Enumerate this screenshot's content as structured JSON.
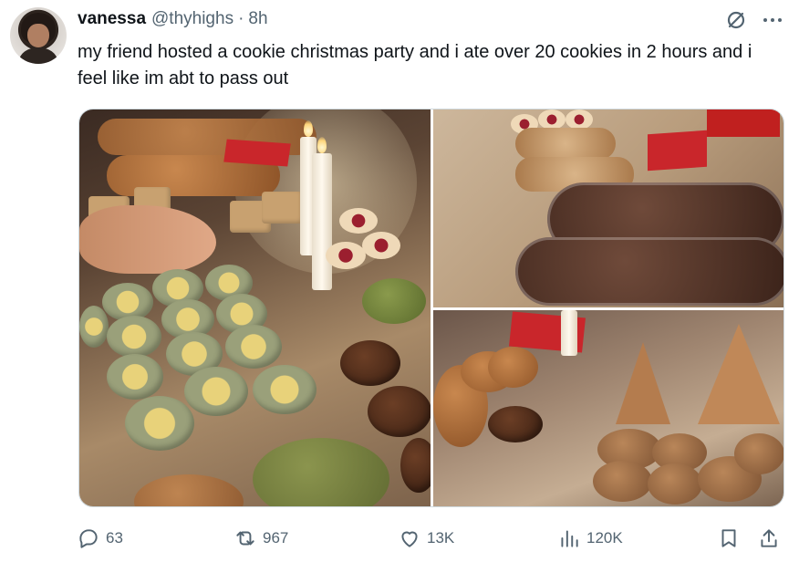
{
  "tweet": {
    "display_name": "vanessa",
    "handle": "@thyhighs",
    "separator": "·",
    "time": "8h",
    "text": "my friend hosted a cookie christmas party and i ate over 20 cookies in 2 hours and i feel like im abt to pass out"
  },
  "media": {
    "photos": [
      "cookie-table-photo",
      "cookie-trays-photo",
      "gingerbread-cookies-photo"
    ]
  },
  "actions": {
    "replies": "63",
    "reposts": "967",
    "likes": "13K",
    "views": "120K"
  },
  "icons": {
    "grok": "grok-icon",
    "more": "more-icon",
    "reply": "reply-icon",
    "repost": "repost-icon",
    "like": "heart-icon",
    "views": "views-icon",
    "bookmark": "bookmark-icon",
    "share": "share-icon"
  },
  "colors": {
    "text": "#0f1419",
    "secondary": "#536471",
    "border": "#cfd9de"
  }
}
